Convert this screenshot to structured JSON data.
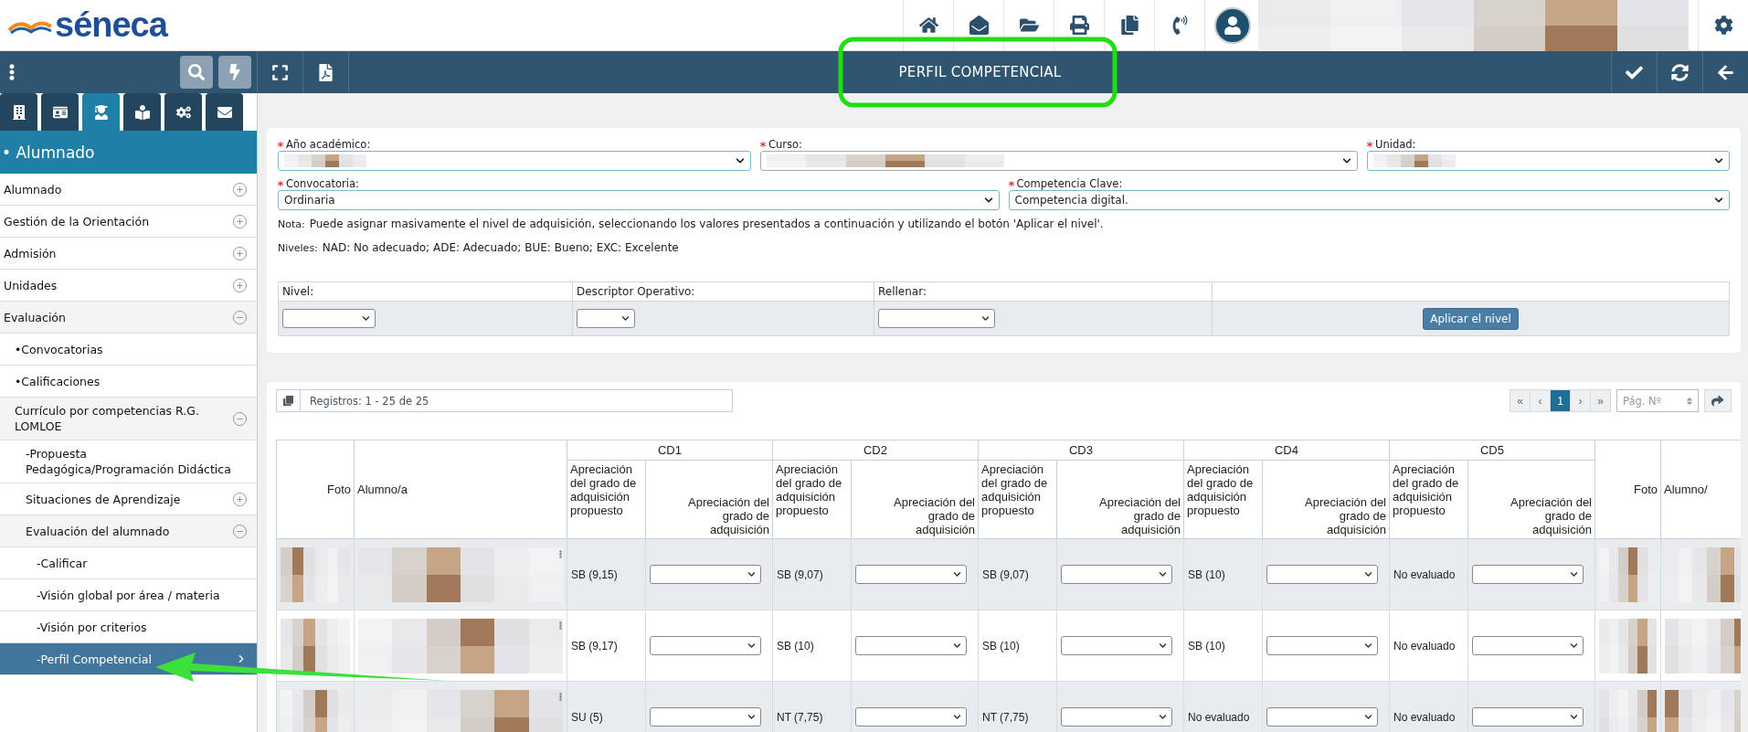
{
  "header": {
    "logo": "séneca"
  },
  "toolbar": {
    "title": "PERFIL COMPETENCIAL"
  },
  "sidebar": {
    "tabs": [
      {
        "selected": false
      },
      {
        "selected": false
      },
      {
        "selected": true
      },
      {
        "selected": false
      },
      {
        "selected": false
      },
      {
        "selected": false
      }
    ],
    "section_title": "• Alumnado",
    "items": [
      {
        "label": "Alumnado",
        "expanded": false,
        "selected": false
      },
      {
        "label": "Gestión de la Orientación",
        "expanded": false,
        "selected": false
      },
      {
        "label": "Admisión",
        "expanded": false,
        "selected": false
      },
      {
        "label": "Unidades",
        "expanded": false,
        "selected": false
      },
      {
        "label": "Evaluación",
        "expanded": true,
        "selected": false,
        "children": [
          {
            "label": "•Convocatorias",
            "selected": false
          },
          {
            "label": "•Calificaciones",
            "selected": false
          },
          {
            "label": "Currículo por competencias R.G. LOMLOE",
            "expanded": true,
            "selected": false,
            "children": [
              {
                "label": "-Propuesta Pedagógica/Programación Didáctica",
                "selected": false
              },
              {
                "label": "Situaciones de Aprendizaje",
                "expanded": false,
                "selected": false
              },
              {
                "label": "Evaluación del alumnado",
                "expanded": true,
                "selected": false,
                "children": [
                  {
                    "label": "-Calificar",
                    "selected": false
                  },
                  {
                    "label": "-Visión global por área / materia",
                    "selected": false
                  },
                  {
                    "label": "-Visión por criterios",
                    "selected": false
                  },
                  {
                    "label": "-Perfil Competencial",
                    "selected": true
                  }
                ]
              }
            ]
          }
        ]
      }
    ]
  },
  "form": {
    "rows": [
      [
        {
          "label": "Año académico:",
          "required": true
        },
        {
          "label": "Curso:",
          "required": true
        },
        {
          "label": "Unidad:",
          "required": true
        }
      ],
      [
        {
          "label": "Convocatoria:",
          "required": true,
          "value": "Ordinaria"
        },
        {
          "label": "Competencia Clave:",
          "required": true,
          "value": "Competencia digital."
        }
      ]
    ],
    "note": {
      "label": "Nota:",
      "text": "Puede asignar masivamente el nivel de adquisición, seleccionando los valores presentados a continuación y utilizando el botón 'Aplicar el nivel'."
    },
    "levels": {
      "label": "Niveles:",
      "text": "NAD: No adecuado; ADE: Adecuado; BUE: Bueno; EXC: Excelente"
    },
    "bulk": {
      "columns": [
        "Nivel:",
        "Descriptor Operativo:",
        "Rellenar:"
      ],
      "button": "Aplicar el nivel"
    }
  },
  "grid": {
    "records": "Registros: 1 - 25 de 25",
    "pager": [
      {
        "label": "«",
        "selected": false
      },
      {
        "label": "‹",
        "selected": false
      },
      {
        "label": "1",
        "selected": true
      },
      {
        "label": "›",
        "selected": false
      },
      {
        "label": "»",
        "selected": false
      }
    ],
    "page_placeholder": "Pág. Nº",
    "columns_left": [
      "Foto",
      "Alumno/a"
    ],
    "groups": [
      {
        "label": "CD1",
        "sub_columns": [
          "Apreciación del grado de adquisición propuesto",
          "Apreciación del grado de adquisición"
        ]
      },
      {
        "label": "CD2",
        "sub_columns": [
          "Apreciación del grado de adquisición propuesto",
          "Apreciación del grado de adquisición"
        ]
      },
      {
        "label": "CD3",
        "sub_columns": [
          "Apreciación del grado de adquisición propuesto",
          "Apreciación del grado de adquisición"
        ]
      },
      {
        "label": "CD4",
        "sub_columns": [
          "Apreciación del grado de adquisición propuesto",
          "Apreciación del grado de adquisición"
        ]
      },
      {
        "label": "CD5",
        "sub_columns": [
          "Apreciación del grado de adquisición propuesto",
          "Apreciación del grado de adquisición"
        ]
      }
    ],
    "columns_right": [
      "Foto",
      "Alumno/"
    ],
    "rows": [
      {
        "proposed": [
          "SB (9,15)",
          "SB (9,07)",
          "SB (9,07)",
          "SB (10)",
          "No evaluado"
        ]
      },
      {
        "proposed": [
          "SB (9,17)",
          "SB (10)",
          "SB (10)",
          "SB (10)",
          "No evaluado"
        ]
      },
      {
        "proposed": [
          "SU (5)",
          "NT (7,75)",
          "NT (7,75)",
          "No evaluado",
          "No evaluado"
        ]
      }
    ]
  }
}
